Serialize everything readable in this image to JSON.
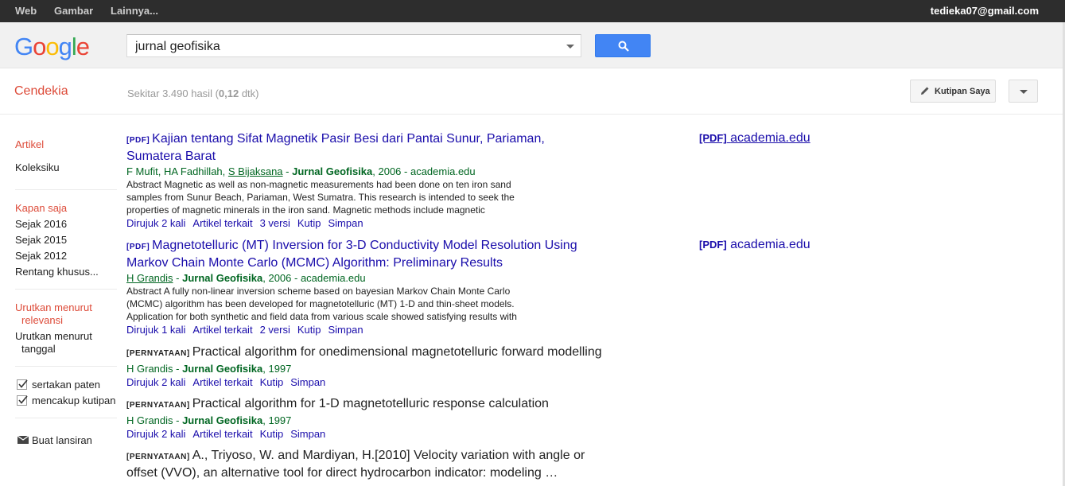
{
  "topnav": {
    "items": [
      "Web",
      "Gambar",
      "Lainnya..."
    ],
    "email": "tedieka07@gmail.com"
  },
  "header": {
    "logo_letters": [
      "G",
      "o",
      "o",
      "g",
      "l",
      "e"
    ],
    "logo_colors": [
      "#4285f4",
      "#ea4335",
      "#fbbc05",
      "#4285f4",
      "#34a853",
      "#ea4335"
    ],
    "search_value": "jurnal geofisika"
  },
  "subheader": {
    "section": "Cendekia",
    "stats_prefix": "Sekitar 3.490 hasil (",
    "stats_time": "0,12",
    "stats_suffix": " dtk)",
    "my_citations": "Kutipan Saya"
  },
  "sidebar": {
    "articles": "Artikel",
    "library": "Koleksiku",
    "anytime": "Kapan saja",
    "since2016": "Sejak 2016",
    "since2015": "Sejak 2015",
    "since2012": "Sejak 2012",
    "custom": "Rentang khusus...",
    "sort_relevance_1": "Urutkan menurut",
    "sort_relevance_2": "relevansi",
    "sort_date_1": "Urutkan menurut",
    "sort_date_2": "tanggal",
    "include_patents": "sertakan paten",
    "include_citations": "mencakup kutipan",
    "create_alert": "Buat lansiran"
  },
  "results": [
    {
      "tag": "[PDF]",
      "title_1": "Kajian tentang Sifat Magnetik Pasir Besi dari Pantai Sunur, Pariaman,",
      "title_2": "Sumatera Barat",
      "authors_plain": "F Mufit, HA Fadhillah, ",
      "authors_link": "S Bijaksana",
      "journal": "Jurnal Geofisika",
      "meta": ", 2006 - academia.edu",
      "snippet_1": "Abstract Magnetic as well as non-magnetic measurements had been done on ten iron sand",
      "snippet_2": "samples from Sunur Beach, Pariaman, West Sumatra. This research is intended to seek the",
      "snippet_3": "properties of magnetic minerals in the iron sand. Magnetic methods include magnetic",
      "links": [
        "Dirujuk 2 kali",
        "Artikel terkait",
        "3 versi",
        "Kutip",
        "Simpan"
      ],
      "side_tag": "[PDF]",
      "side_domain": "academia.edu"
    },
    {
      "tag": "[PDF]",
      "title_1": "Magnetotelluric (MT) Inversion for 3-D Conductivity Model Resolution Using",
      "title_2": "Markov Chain Monte Carlo (MCMC) Algorithm: Preliminary Results",
      "authors_link": "H Grandis",
      "journal": "Jurnal Geofisika",
      "meta": ", 2006 - academia.edu",
      "snippet_1": "Abstract A fully non-linear inversion scheme based on bayesian Markov Chain Monte Carlo",
      "snippet_2": "(MCMC) algorithm has been developed for magnetotelluric (MT) 1-D and thin-sheet models.",
      "snippet_3": "Application for both synthetic and field data from various scale showed satisfying results with",
      "links": [
        "Dirujuk 1 kali",
        "Artikel terkait",
        "2 versi",
        "Kutip",
        "Simpan"
      ],
      "side_tag": "[PDF]",
      "side_domain": "academia.edu"
    },
    {
      "tag": "[PERNYATAAN]",
      "title_1": "Practical algorithm for onedimensional magnetotelluric forward modelling",
      "authors_plain": "H Grandis - ",
      "journal": "Jurnal Geofisika",
      "meta": ", 1997",
      "links": [
        "Dirujuk 2 kali",
        "Artikel terkait",
        "Kutip",
        "Simpan"
      ]
    },
    {
      "tag": "[PERNYATAAN]",
      "title_1": "Practical algorithm for 1-D magnetotelluric response calculation",
      "authors_plain": "H Grandis - ",
      "journal": "Jurnal Geofisika",
      "meta": ", 1997",
      "links": [
        "Dirujuk 2 kali",
        "Artikel terkait",
        "Kutip",
        "Simpan"
      ]
    },
    {
      "tag": "[PERNYATAAN]",
      "title_1": "A., Triyoso, W. and Mardiyan, H.[2010] Velocity variation with angle or",
      "title_2": "offset (VVO), an alternative tool for direct hydrocarbon indicator: modeling …"
    }
  ]
}
